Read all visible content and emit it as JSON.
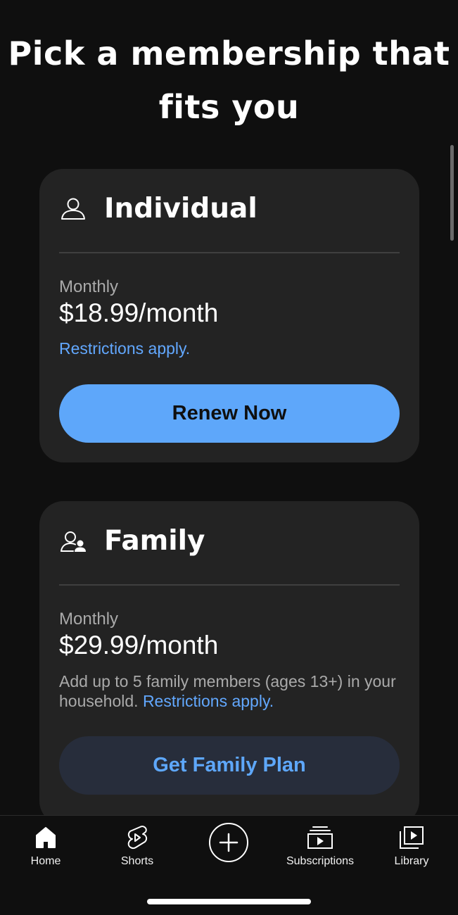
{
  "heading": {
    "line1": "Pick a membership that",
    "line2": "fits you"
  },
  "plans": {
    "individual": {
      "icon": "person-icon",
      "name": "Individual",
      "period": "Monthly",
      "price": "$18.99/month",
      "restrictions": "Restrictions apply.",
      "button": "Renew Now"
    },
    "family": {
      "icon": "family-icon",
      "name": "Family",
      "period": "Monthly",
      "price": "$29.99/month",
      "description": "Add up to 5 family members (ages 13+) in your household.",
      "restrictions": "Restrictions apply.",
      "button": "Get Family Plan"
    }
  },
  "nav": {
    "home": "Home",
    "shorts": "Shorts",
    "create_icon": "plus-circle-icon",
    "subscriptions": "Subscriptions",
    "library": "Library"
  },
  "colors": {
    "background": "#0f0f0f",
    "card": "#232323",
    "accent": "#5ea7fa",
    "link": "#62a8ff",
    "secondary_button": "#272d3b"
  }
}
